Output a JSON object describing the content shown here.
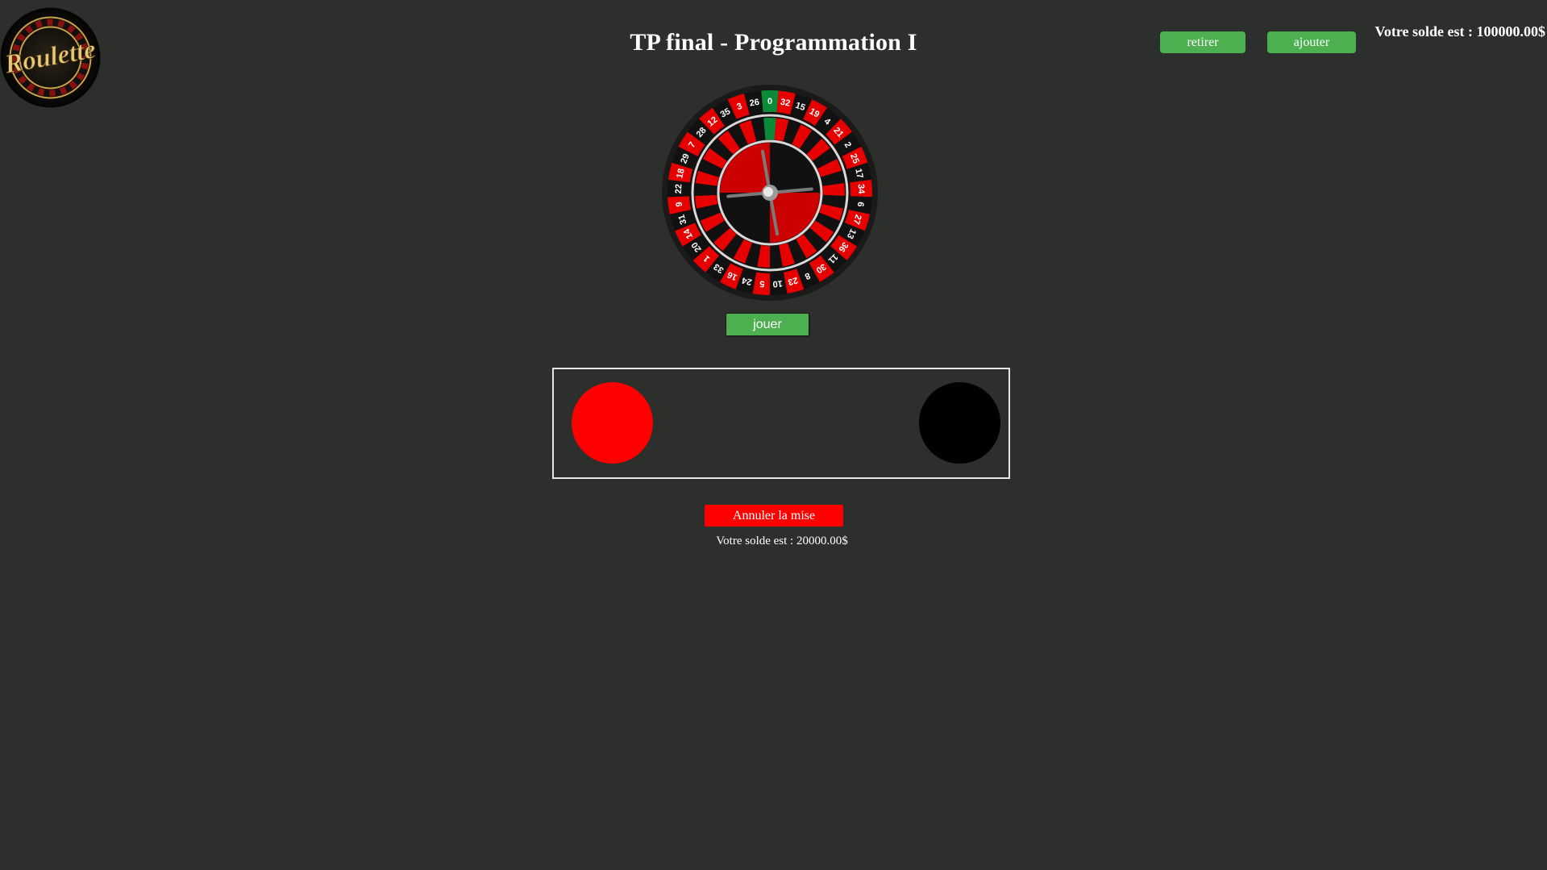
{
  "header": {
    "logo_text": "Roulette",
    "title": "TP final - Programmation I",
    "withdraw_label": "retirer",
    "add_label": "ajouter",
    "balance_text": "Votre solde est : 100000.00$"
  },
  "wheel": {
    "numbers": [
      0,
      32,
      15,
      19,
      4,
      21,
      2,
      25,
      17,
      34,
      6,
      27,
      13,
      36,
      11,
      30,
      8,
      23,
      10,
      5,
      24,
      16,
      33,
      1,
      20,
      14,
      31,
      9,
      22,
      18,
      29,
      7,
      28,
      12,
      35,
      3,
      26
    ],
    "colors": {
      "red": "#e60000",
      "black": "#111111",
      "green": "#0b8a3a"
    }
  },
  "controls": {
    "play_label": "jouer"
  },
  "bets": {
    "red_color": "#ff0000",
    "black_color": "#000000"
  },
  "footer": {
    "cancel_label": "Annuler la mise",
    "balance_text": "Votre solde est : 20000.00$"
  }
}
